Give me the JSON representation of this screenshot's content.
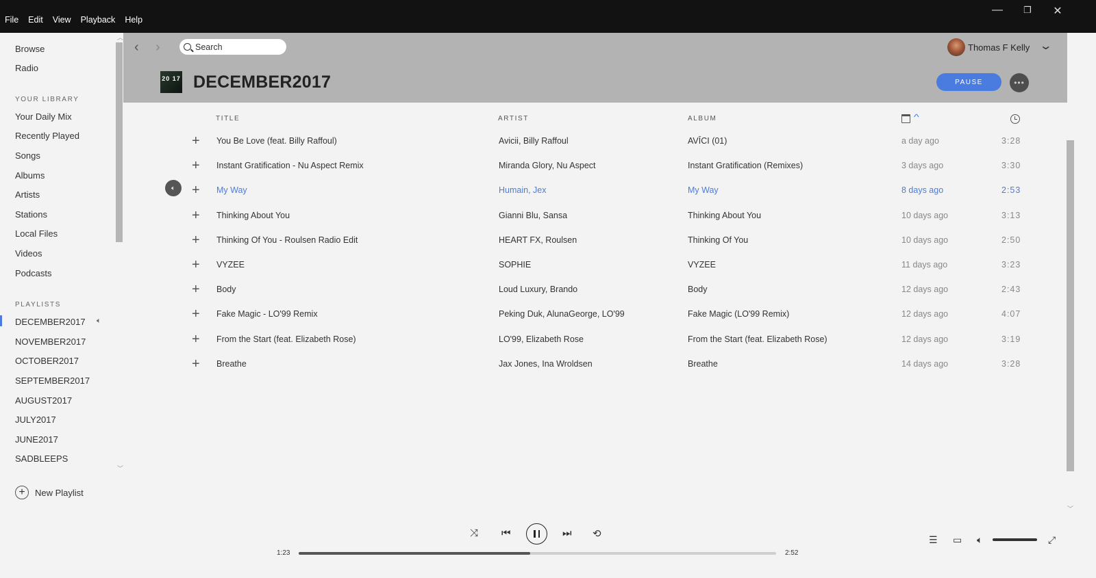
{
  "menu": [
    "File",
    "Edit",
    "View",
    "Playback",
    "Help"
  ],
  "window_controls": {
    "minimize": "—",
    "restore": "❐",
    "close": "✕"
  },
  "sidebar": {
    "nav": [
      "Browse",
      "Radio"
    ],
    "library_heading": "YOUR LIBRARY",
    "library": [
      "Your Daily Mix",
      "Recently Played",
      "Songs",
      "Albums",
      "Artists",
      "Stations",
      "Local Files",
      "Videos",
      "Podcasts"
    ],
    "playlists_heading": "PLAYLISTS",
    "playlists": [
      "DECEMBER2017",
      "NOVEMBER2017",
      "OCTOBER2017",
      "SEPTEMBER2017",
      "AUGUST2017",
      "JULY2017",
      "JUNE2017",
      "SADBLEEPS"
    ],
    "active_playlist": "DECEMBER2017",
    "new_playlist": "New Playlist"
  },
  "header": {
    "search_placeholder": "Search",
    "user_name": "Thomas F Kelly",
    "cover_text": "20 17",
    "playlist_title": "DECEMBER2017",
    "pause_label": "PAUSE",
    "more_label": "•••"
  },
  "columns": {
    "title": "TITLE",
    "artist": "ARTIST",
    "album": "ALBUM"
  },
  "tracks": [
    {
      "title": "You Be Love (feat. Billy Raffoul)",
      "artist": "Avicii, Billy Raffoul",
      "album": "AVĪCI (01)",
      "added": "a day ago",
      "duration": "3:28"
    },
    {
      "title": "Instant Gratification - Nu Aspect Remix",
      "artist": "Miranda Glory, Nu Aspect",
      "album": "Instant Gratification (Remixes)",
      "added": "3 days ago",
      "duration": "3:30"
    },
    {
      "title": "My Way",
      "artist": "Humain, Jex",
      "album": "My Way",
      "added": "8 days ago",
      "duration": "2:53"
    },
    {
      "title": "Thinking About You",
      "artist": "Gianni Blu, Sansa",
      "album": "Thinking About You",
      "added": "10 days ago",
      "duration": "3:13"
    },
    {
      "title": "Thinking Of You - Roulsen Radio Edit",
      "artist": "HEART FX, Roulsen",
      "album": "Thinking Of You",
      "added": "10 days ago",
      "duration": "2:50"
    },
    {
      "title": "VYZEE",
      "artist": "SOPHIE",
      "album": "VYZEE",
      "added": "11 days ago",
      "duration": "3:23"
    },
    {
      "title": "Body",
      "artist": "Loud Luxury, Brando",
      "album": "Body",
      "added": "12 days ago",
      "duration": "2:43"
    },
    {
      "title": "Fake Magic - LO'99 Remix",
      "artist": "Peking Duk, AlunaGeorge, LO'99",
      "album": "Fake Magic (LO'99 Remix)",
      "added": "12 days ago",
      "duration": "4:07"
    },
    {
      "title": "From the Start (feat. Elizabeth Rose)",
      "artist": "LO'99, Elizabeth Rose",
      "album": "From the Start (feat. Elizabeth Rose)",
      "added": "12 days ago",
      "duration": "3:19"
    },
    {
      "title": "Breathe",
      "artist": "Jax Jones, Ina Wroldsen",
      "album": "Breathe",
      "added": "14 days ago",
      "duration": "3:28"
    }
  ],
  "playing_index": 2,
  "player": {
    "elapsed": "1:23",
    "total": "2:52",
    "progress_fraction": 0.485,
    "volume_fraction": 1.0
  },
  "colors": {
    "accent": "#4a7cdf",
    "titlebar": "#121212",
    "header_bg": "#b3b3b3"
  }
}
